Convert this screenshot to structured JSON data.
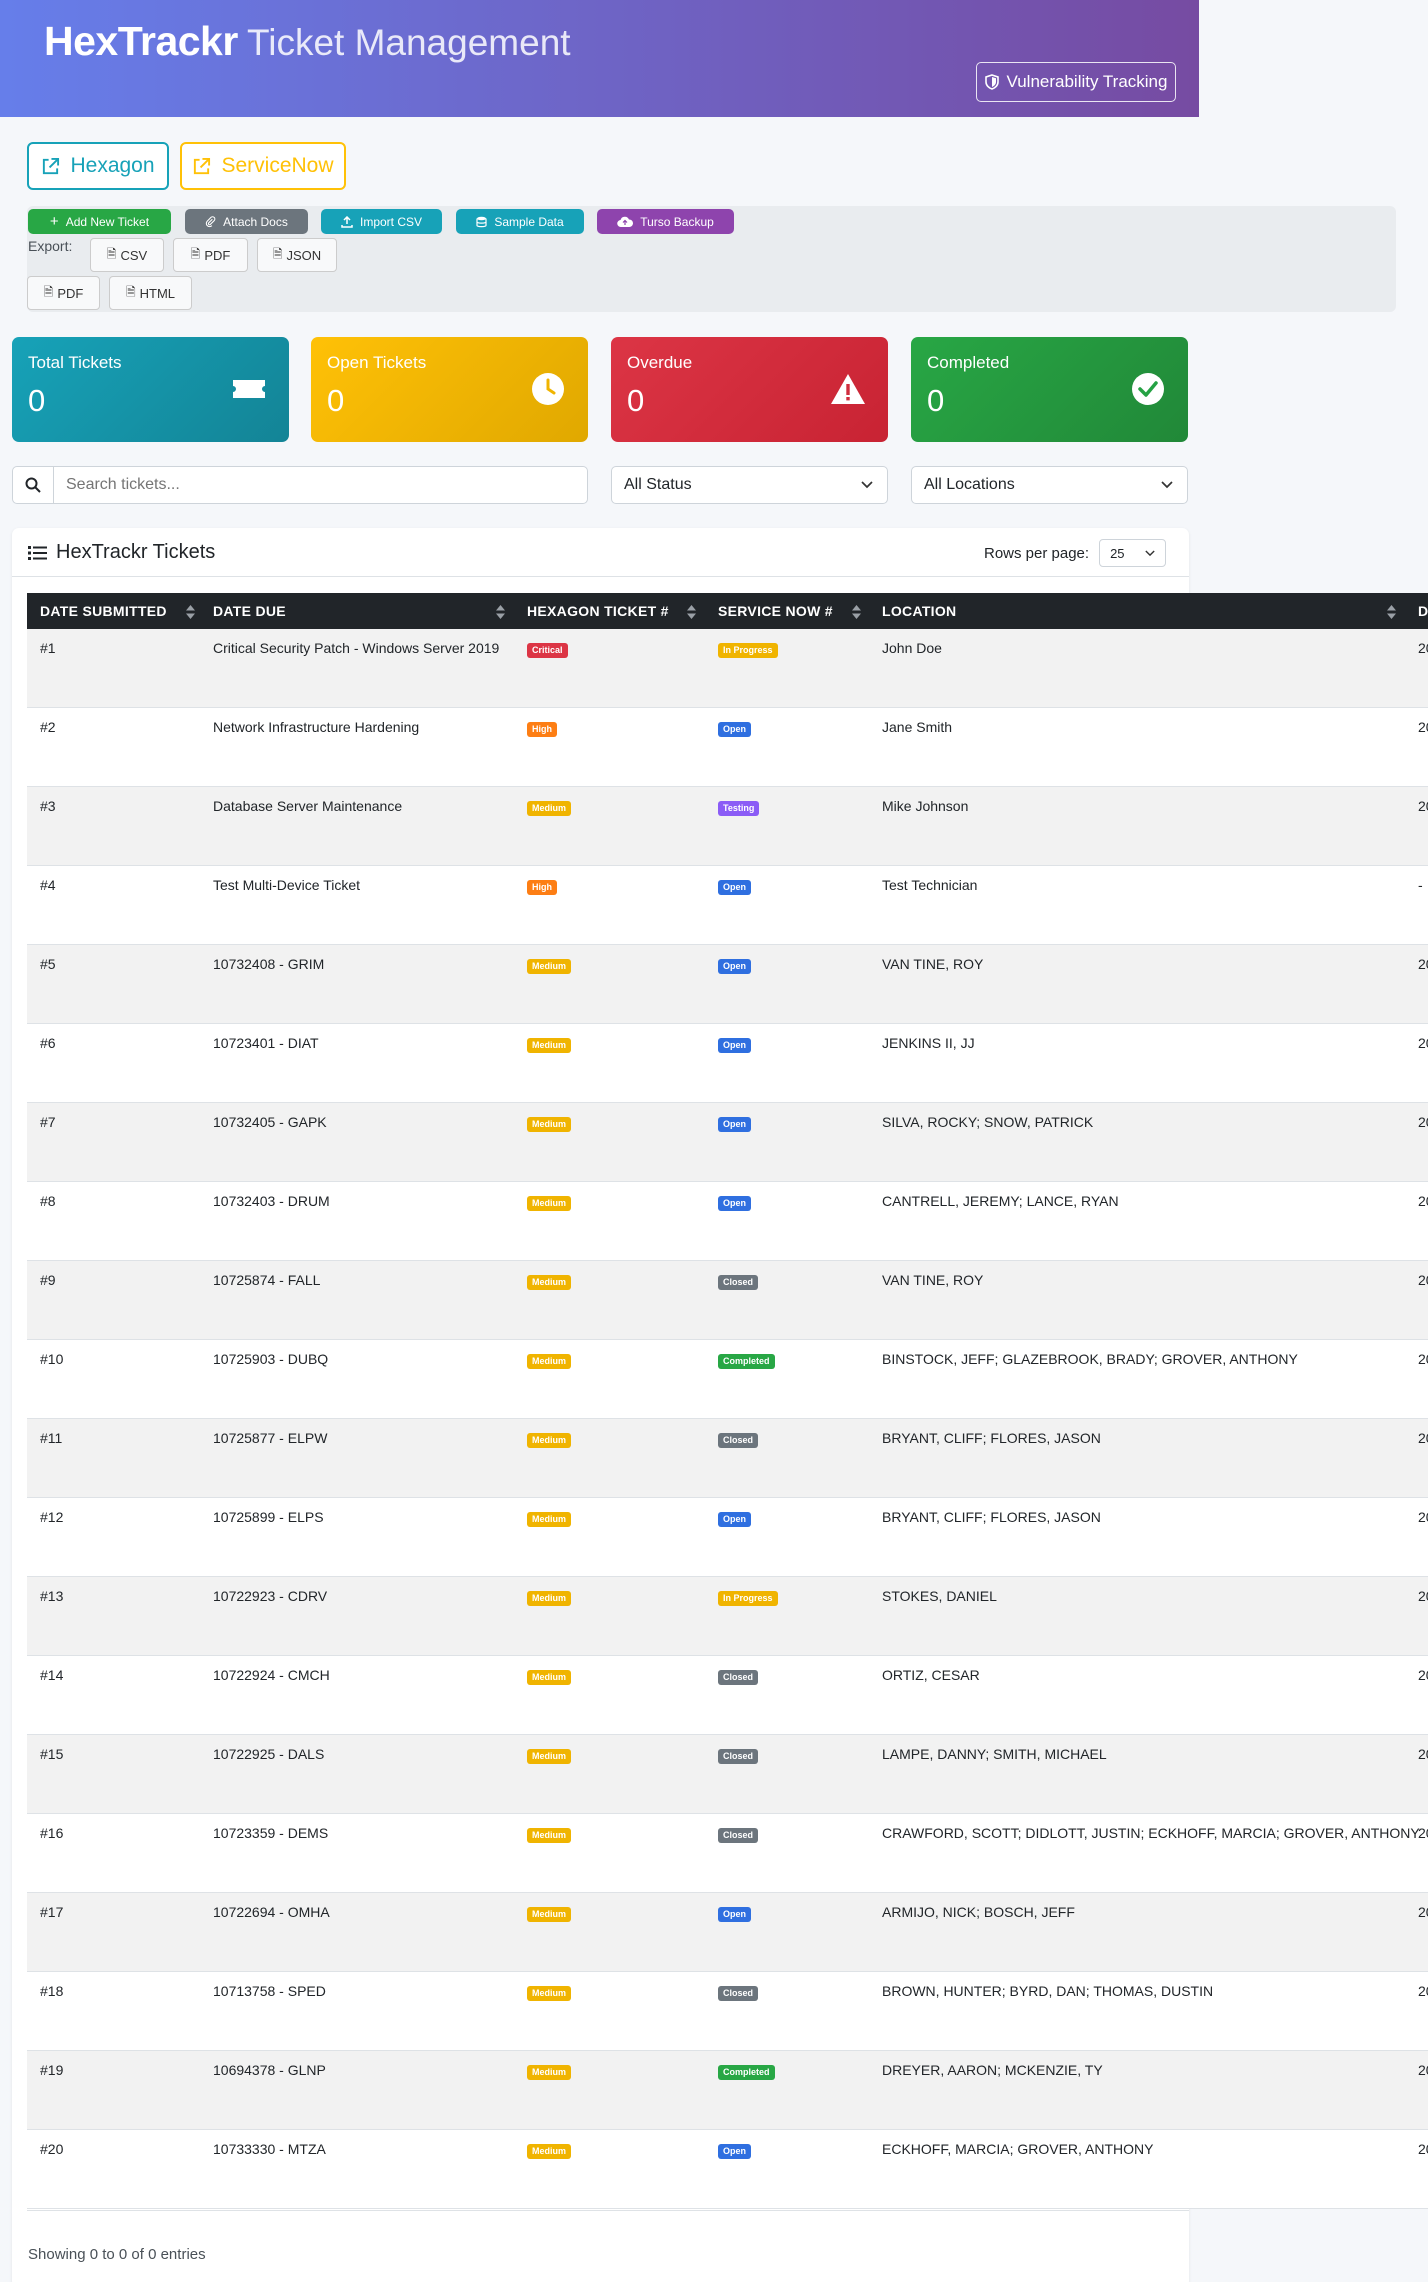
{
  "header": {
    "brand": "HexTrackr",
    "subtitle": "Ticket Management",
    "vuln_button": "Vulnerability Tracking"
  },
  "nav": {
    "hexagon": "Hexagon",
    "servicenow": "ServiceNow"
  },
  "toolbar": {
    "add": "Add New Ticket",
    "attach": "Attach Docs",
    "import": "Import CSV",
    "sample": "Sample Data",
    "turso": "Turso Backup",
    "export_label": "Export:",
    "csv": "CSV",
    "pdf": "PDF",
    "json": "JSON",
    "pdf2": "PDF",
    "html": "HTML"
  },
  "stats": [
    {
      "title": "Total Tickets",
      "value": "0",
      "icon": "ticket-icon",
      "color": "#17a2b8"
    },
    {
      "title": "Open Tickets",
      "value": "0",
      "icon": "clock-icon",
      "color": "#ffc107"
    },
    {
      "title": "Overdue",
      "value": "0",
      "icon": "warning-icon",
      "color": "#dc3545"
    },
    {
      "title": "Completed",
      "value": "0",
      "icon": "check-circle-icon",
      "color": "#28a745"
    }
  ],
  "filters": {
    "search_placeholder": "Search tickets...",
    "status": "All Status",
    "location": "All Locations"
  },
  "table": {
    "title": "HexTrackr Tickets",
    "rows_per_page_label": "Rows per page:",
    "rows_per_page": "25",
    "columns": [
      "DATE SUBMITTED",
      "DATE DUE",
      "HEXAGON TICKET #",
      "SERVICE NOW #",
      "LOCATION",
      "D"
    ],
    "rows": [
      {
        "id": "#1",
        "title": "Critical Security Patch - Windows Server 2019",
        "priority": "Critical",
        "status": "In Progress",
        "assignee": "John Doe",
        "extra": "20"
      },
      {
        "id": "#2",
        "title": "Network Infrastructure Hardening",
        "priority": "High",
        "status": "Open",
        "assignee": "Jane Smith",
        "extra": "20"
      },
      {
        "id": "#3",
        "title": "Database Server Maintenance",
        "priority": "Medium",
        "status": "Testing",
        "assignee": "Mike Johnson",
        "extra": "20"
      },
      {
        "id": "#4",
        "title": "Test Multi-Device Ticket",
        "priority": "High",
        "status": "Open",
        "assignee": "Test Technician",
        "extra": "-"
      },
      {
        "id": "#5",
        "title": "10732408 - GRIM",
        "priority": "Medium",
        "status": "Open",
        "assignee": "VAN TINE, ROY",
        "extra": "20"
      },
      {
        "id": "#6",
        "title": "10723401 - DIAT",
        "priority": "Medium",
        "status": "Open",
        "assignee": "JENKINS II, JJ",
        "extra": "20"
      },
      {
        "id": "#7",
        "title": "10732405 - GAPK",
        "priority": "Medium",
        "status": "Open",
        "assignee": "SILVA, ROCKY; SNOW, PATRICK",
        "extra": "20"
      },
      {
        "id": "#8",
        "title": "10732403 - DRUM",
        "priority": "Medium",
        "status": "Open",
        "assignee": "CANTRELL, JEREMY; LANCE, RYAN",
        "extra": "20"
      },
      {
        "id": "#9",
        "title": "10725874 - FALL",
        "priority": "Medium",
        "status": "Closed",
        "assignee": "VAN TINE, ROY",
        "extra": "20"
      },
      {
        "id": "#10",
        "title": "10725903 - DUBQ",
        "priority": "Medium",
        "status": "Completed",
        "assignee": "BINSTOCK, JEFF; GLAZEBROOK, BRADY; GROVER, ANTHONY",
        "extra": "20"
      },
      {
        "id": "#11",
        "title": "10725877 - ELPW",
        "priority": "Medium",
        "status": "Closed",
        "assignee": "BRYANT, CLIFF; FLORES, JASON",
        "extra": "20"
      },
      {
        "id": "#12",
        "title": "10725899 - ELPS",
        "priority": "Medium",
        "status": "Open",
        "assignee": "BRYANT, CLIFF; FLORES, JASON",
        "extra": "20"
      },
      {
        "id": "#13",
        "title": "10722923 - CDRV",
        "priority": "Medium",
        "status": "In Progress",
        "assignee": "STOKES, DANIEL",
        "extra": "20"
      },
      {
        "id": "#14",
        "title": "10722924 - CMCH",
        "priority": "Medium",
        "status": "Closed",
        "assignee": "ORTIZ, CESAR",
        "extra": "20"
      },
      {
        "id": "#15",
        "title": "10722925 - DALS",
        "priority": "Medium",
        "status": "Closed",
        "assignee": "LAMPE, DANNY; SMITH, MICHAEL",
        "extra": "20"
      },
      {
        "id": "#16",
        "title": "10723359 - DEMS",
        "priority": "Medium",
        "status": "Closed",
        "assignee": "CRAWFORD, SCOTT; DIDLOTT, JUSTIN; ECKHOFF, MARCIA; GROVER, ANTHONY",
        "extra": "20"
      },
      {
        "id": "#17",
        "title": "10722694 - OMHA",
        "priority": "Medium",
        "status": "Open",
        "assignee": "ARMIJO, NICK; BOSCH, JEFF",
        "extra": "20"
      },
      {
        "id": "#18",
        "title": "10713758 - SPED",
        "priority": "Medium",
        "status": "Closed",
        "assignee": "BROWN, HUNTER; BYRD, DAN; THOMAS, DUSTIN",
        "extra": "20"
      },
      {
        "id": "#19",
        "title": "10694378 - GLNP",
        "priority": "Medium",
        "status": "Completed",
        "assignee": "DREYER, AARON; MCKENZIE, TY",
        "extra": "20"
      },
      {
        "id": "#20",
        "title": "10733330 - MTZA",
        "priority": "Medium",
        "status": "Open",
        "assignee": "ECKHOFF, MARCIA; GROVER, ANTHONY",
        "extra": "20"
      }
    ],
    "footer": "Showing 0 to 0 of 0 entries"
  },
  "colors": {
    "priority": {
      "Critical": "#dc3545",
      "High": "#fd7e14",
      "Medium": "#f0b400"
    },
    "status": {
      "In Progress": "#f0b400",
      "Open": "#2f6fe0",
      "Testing": "#8b5cf6",
      "Closed": "#6c757d",
      "Completed": "#28a745"
    }
  }
}
